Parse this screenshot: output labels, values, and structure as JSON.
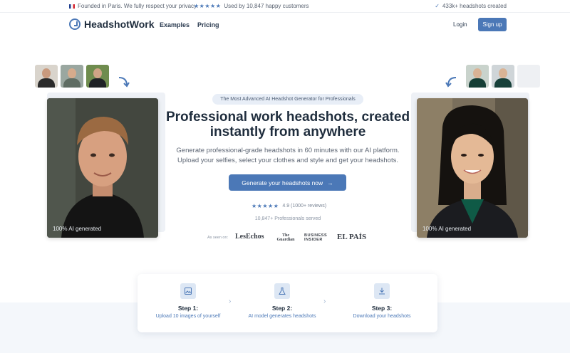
{
  "topbar": {
    "founded": "Founded in Paris. We fully respect your privacy.",
    "stars": "★★★★★",
    "used_by": "Used by 10,847 happy customers",
    "headshots_created": "433k+ headshots created"
  },
  "nav": {
    "logo": "HeadshotWork",
    "examples": "Examples",
    "pricing": "Pricing",
    "login": "Login",
    "signup": "Sign up"
  },
  "hero": {
    "badge": "The Most Advanced AI Headshot Generator for Professionals",
    "headline_line1": "Professional work headshots, created",
    "headline_line2": "instantly from anywhere",
    "sub_line1": "Generate professional-grade headshots in 60 minutes with our AI platform.",
    "sub_line2": "Upload your selfies, select your clothes and style and get your headshots.",
    "cta": "Generate your headshots now",
    "stars": "★★★★★",
    "rating": "4.9 (1000+ reviews)",
    "served": "10,847+ Professionals served",
    "seen_on": "As seen on:",
    "press": [
      "LesEchos",
      "The Guardian",
      "BUSINESS INSIDER",
      "EL PAÍS"
    ]
  },
  "portraits": {
    "left_caption": "100% AI generated",
    "right_caption": "100% AI generated"
  },
  "steps": [
    {
      "title": "Step 1:",
      "desc": "Upload 10 images of yourself",
      "icon": "image-icon"
    },
    {
      "title": "Step 2:",
      "desc": "AI model generates headshots",
      "icon": "flask-icon"
    },
    {
      "title": "Step 3:",
      "desc": "Download your headshots",
      "icon": "download-icon"
    }
  ],
  "colors": {
    "accent": "#4b78b7",
    "text": "#1f2d3d",
    "muted": "#5b6472"
  }
}
